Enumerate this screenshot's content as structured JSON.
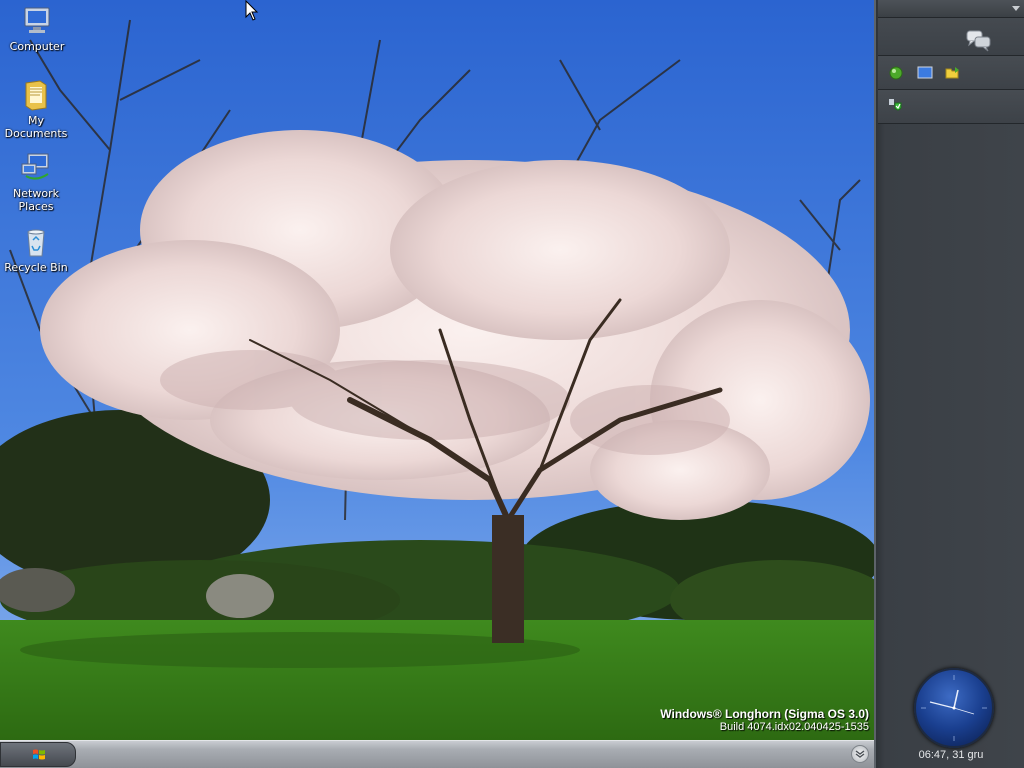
{
  "desktop": {
    "icons": [
      {
        "label": "Computer",
        "icon": "computer-icon"
      },
      {
        "label": "My Documents",
        "icon": "folder-documents-icon"
      },
      {
        "label": "Network Places",
        "icon": "network-places-icon"
      },
      {
        "label": "Recycle Bin",
        "icon": "recycle-bin-icon"
      }
    ],
    "watermark": {
      "line1": "Windows® Longhorn (Sigma OS 3.0)",
      "line2": "Build 4074.idx02.040425-1535"
    }
  },
  "taskbar": {
    "start_icon": "windows-flag-icon",
    "tray_icon": "chevron-down-icon"
  },
  "sidebar": {
    "dropdown_icon": "dropdown-arrow-icon",
    "messenger_icon": "messenger-icon",
    "quick_launch": [
      "green-circle-icon",
      "monitor-icon",
      "folder-arrow-icon"
    ],
    "tray": [
      "security-shield-icon"
    ],
    "clock": {
      "text": "06:47, 31 gru"
    }
  },
  "colors": {
    "sky": "#3d72d6",
    "sidebar": "#3f444a",
    "taskbar": "#a9adb3",
    "clock": "#1a3f8f"
  }
}
